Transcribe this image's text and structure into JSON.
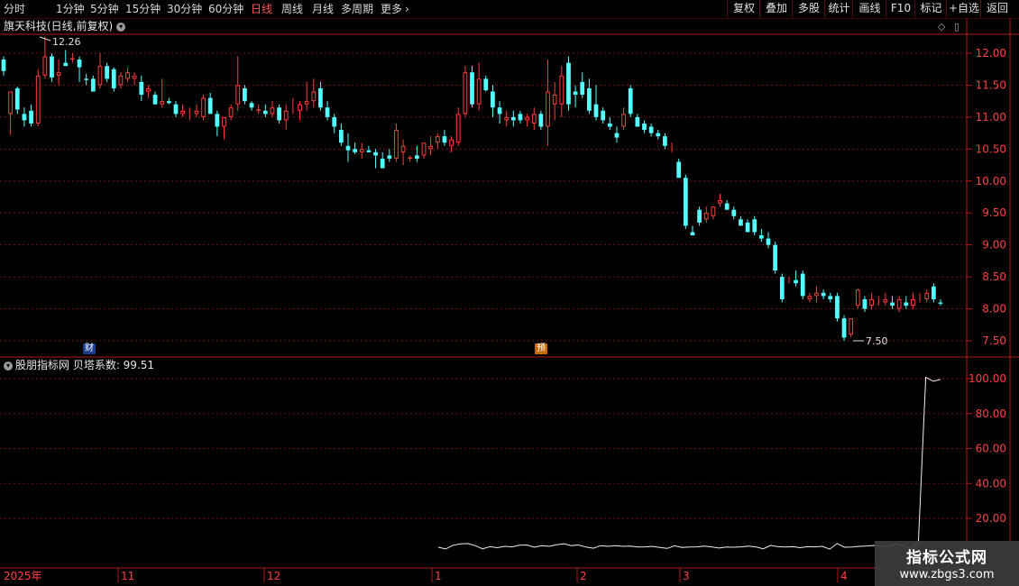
{
  "toolbar": {
    "periods": [
      "分时",
      "1分钟",
      "5分钟",
      "15分钟",
      "30分钟",
      "60分钟",
      "日线",
      "周线",
      "月线",
      "多周期",
      "更多"
    ],
    "active_period": "日线",
    "right_buttons": [
      "复权",
      "叠加",
      "多股",
      "统计",
      "画线",
      "F10",
      "标记",
      "+自选",
      "返回"
    ]
  },
  "stock": {
    "title": "旗天科技(日线,前复权)",
    "high_label": "12.26",
    "low_label": "7.50",
    "badge_fin": "财",
    "badge_pre": "预"
  },
  "price_axis": {
    "ticks": [
      "12.00",
      "11.50",
      "11.00",
      "10.50",
      "10.00",
      "9.50",
      "9.00",
      "8.50",
      "8.00",
      "7.50"
    ]
  },
  "indicator": {
    "title": "股朋指标网 贝塔系数: 99.51",
    "ticks": [
      "100.00",
      "80.00",
      "60.00",
      "40.00",
      "20.00"
    ]
  },
  "date_axis": {
    "labels": [
      "2025年",
      "11",
      "12",
      "1",
      "2",
      "3",
      "4"
    ]
  },
  "watermark": {
    "line1": "指标公式网",
    "line2": "www.zbgs3.com"
  },
  "colors": {
    "up": "#ff3c3c",
    "down": "#54ffff",
    "grid": "#7a1010",
    "frame": "#b01a1a"
  }
}
